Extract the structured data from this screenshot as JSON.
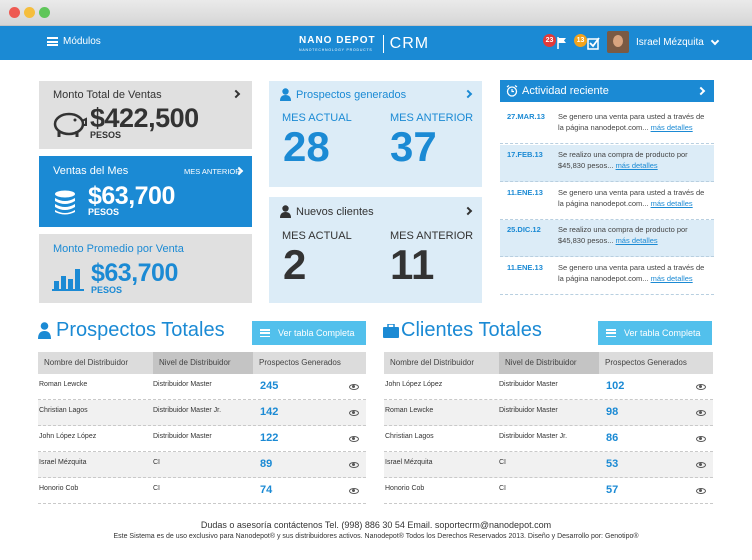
{
  "header": {
    "menu_label": "Módulos",
    "logo_text": "NANO DEPOT",
    "logo_sub": "NANOTECHNOLOGY PRODUCTS",
    "logo_crm": "CRM",
    "notif_flags": "23",
    "notif_tasks": "13",
    "user_name": "Israel Mézquita"
  },
  "cards": {
    "total": {
      "title": "Monto Total de Ventas",
      "value": "$422,500",
      "unit": "PESOS"
    },
    "month": {
      "title": "Ventas del Mes",
      "link": "MES ANTERIOR",
      "value": "$63,700",
      "unit": "PESOS"
    },
    "avg": {
      "title": "Monto Promedio por Venta",
      "value": "$63,700",
      "unit": "PESOS"
    },
    "prospects": {
      "title": "Prospectos generados",
      "current_label": "MES ACTUAL",
      "current_value": "28",
      "prev_label": "MES ANTERIOR",
      "prev_value": "37"
    },
    "clients": {
      "title": "Nuevos clientes",
      "current_label": "MES ACTUAL",
      "current_value": "2",
      "prev_label": "MES ANTERIOR",
      "prev_value": "11"
    }
  },
  "activity": {
    "title": "Actividad reciente",
    "link_label": "más detalles",
    "items": [
      {
        "date": "27.MAR.13",
        "text": "Se genero una venta para usted a través de la página nanodepot.com..."
      },
      {
        "date": "17.FEB.13",
        "text": "Se realizo una compra de producto por $45,830 pesos..."
      },
      {
        "date": "11.ENE.13",
        "text": "Se genero una venta para usted a través de la página nanodepot.com..."
      },
      {
        "date": "25.DIC.12",
        "text": "Se realizo una compra de producto por $45,830 pesos..."
      },
      {
        "date": "11.ENE.13",
        "text": "Se genero una venta para usted a través de la página nanodepot.com..."
      }
    ]
  },
  "prospects_table": {
    "title": "Prospectos Totales",
    "button": "Ver tabla Completa",
    "columns": [
      "Nombre del Distribuidor",
      "Nivel de Distribuidor",
      "Prospectos Generados"
    ],
    "rows": [
      {
        "name": "Roman Lewcke",
        "level": "Distribuidor Master",
        "value": "245"
      },
      {
        "name": "Christian Lagos",
        "level": "Distribuidor Master Jr.",
        "value": "142"
      },
      {
        "name": "John López López",
        "level": "Distribuidor Master",
        "value": "122"
      },
      {
        "name": "Israel Mézquita",
        "level": "CI",
        "value": "89"
      },
      {
        "name": "Honorio Cob",
        "level": "CI",
        "value": "74"
      }
    ]
  },
  "clients_table": {
    "title": "Clientes Totales",
    "button": "Ver tabla Completa",
    "columns": [
      "Nombre del Distribuidor",
      "Nivel de Distribuidor",
      "Prospectos Generados"
    ],
    "rows": [
      {
        "name": "John López López",
        "level": "Distribuidor Master",
        "value": "102"
      },
      {
        "name": "Roman Lewcke",
        "level": "Distribuidor Master",
        "value": "98"
      },
      {
        "name": "Christian Lagos",
        "level": "Distribuidor Master Jr.",
        "value": "86"
      },
      {
        "name": "Israel Mézquita",
        "level": "CI",
        "value": "53"
      },
      {
        "name": "Honorio Cob",
        "level": "CI",
        "value": "57"
      }
    ]
  },
  "footer": {
    "contact": "Dudas o asesoría contáctenos Tel. (998) 886 30 54 Email. soportecrm@nanodepot.com",
    "legal": "Este Sistema es de uso exclusivo para Nanodepot® y sus distribuidores activos. Nanodepot® Todos los Derechos Reservados 2013. Diseño y Desarrollo por: Genotipo®"
  },
  "colors": {
    "primary": "#1b8ad4",
    "light_blue": "#dcecf7",
    "grey_card": "#e0e0e0",
    "button": "#52c0ec",
    "badge_red": "#e23a3a",
    "badge_orange": "#f2a31b"
  }
}
